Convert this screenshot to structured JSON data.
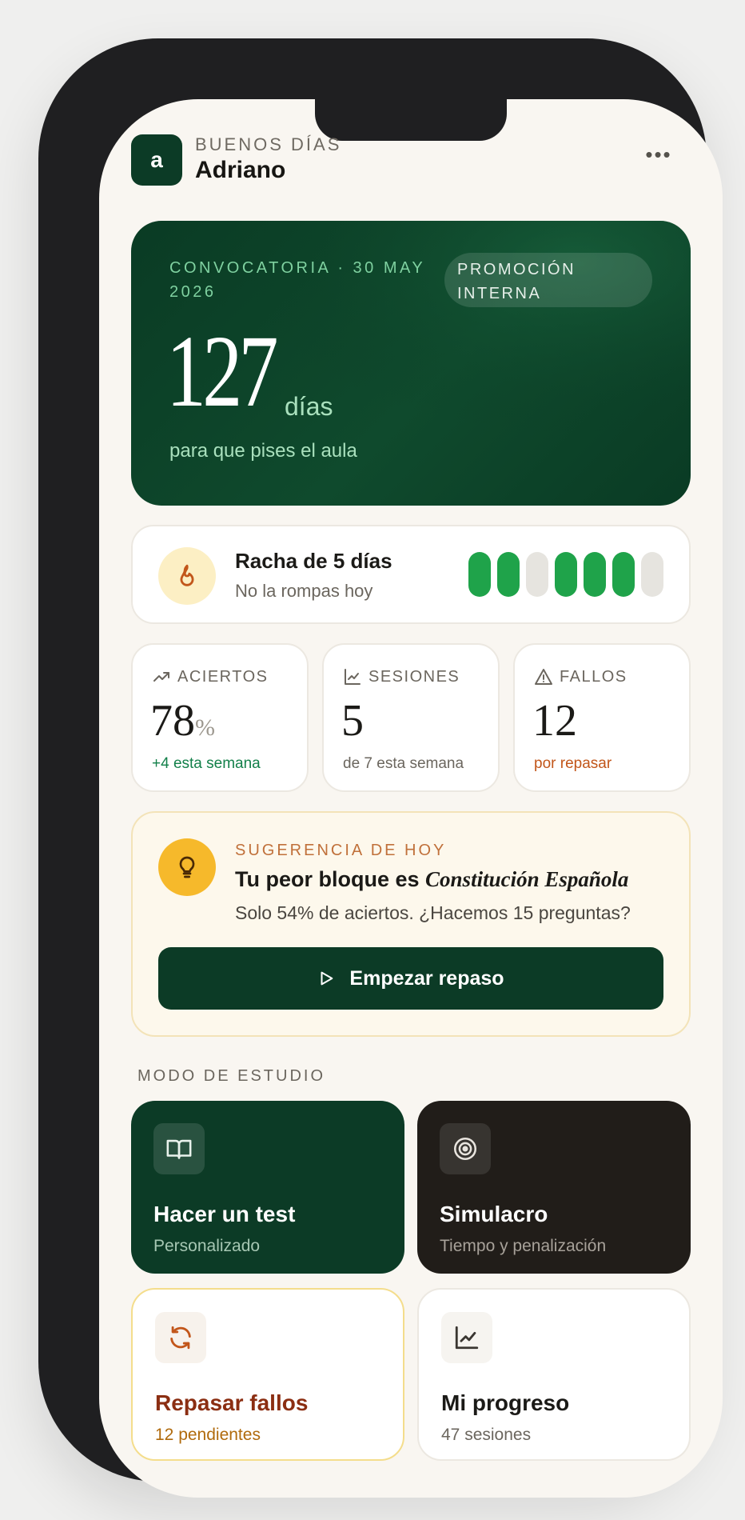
{
  "header": {
    "avatar_letter": "a",
    "greeting": "BUENOS DÍAS",
    "user_name": "Adriano",
    "more_label": "•••"
  },
  "hero": {
    "convocatoria": "CONVOCATORIA · 30 MAY 2026",
    "badge": "PROMOCIÓN INTERNA",
    "days_count": "127",
    "days_unit": "días",
    "subtitle": "para que pises el aula"
  },
  "streak": {
    "title": "Racha de 5 días",
    "subtitle": "No la rompas hoy",
    "days": [
      true,
      true,
      false,
      true,
      true,
      true,
      false
    ]
  },
  "stats": [
    {
      "label": "ACIERTOS",
      "value": "78",
      "suffix": "%",
      "note": "+4 esta semana",
      "note_color": "#13804a",
      "icon": "trending-up-icon"
    },
    {
      "label": "SESIONES",
      "value": "5",
      "suffix": "",
      "note": "de 7 esta semana",
      "note_color": "#6b665e",
      "icon": "line-chart-icon"
    },
    {
      "label": "FALLOS",
      "value": "12",
      "suffix": "",
      "note": "por repasar",
      "note_color": "#c2561a",
      "icon": "warning-icon"
    }
  ],
  "suggestion": {
    "label": "SUGERENCIA DE HOY",
    "title_prefix": "Tu peor bloque es",
    "title_topic": "Constitución Española",
    "subtitle": "Solo 54% de aciertos. ¿Hacemos 15 preguntas?",
    "cta_label": "Empezar repaso"
  },
  "section_title": "MODO DE ESTUDIO",
  "modes": {
    "test": {
      "title": "Hacer un test",
      "subtitle": "Personalizado"
    },
    "simulacro": {
      "title": "Simulacro",
      "subtitle": "Tiempo y penalización"
    },
    "fallos": {
      "title": "Repasar fallos",
      "subtitle": "12 pendientes"
    },
    "progreso": {
      "title": "Mi progreso",
      "subtitle": "47 sesiones"
    }
  },
  "colors": {
    "brand_green": "#0c3b26",
    "streak_on": "#1fa34a",
    "accent_orange": "#c2561a",
    "accent_yellow": "#f6b92b"
  }
}
